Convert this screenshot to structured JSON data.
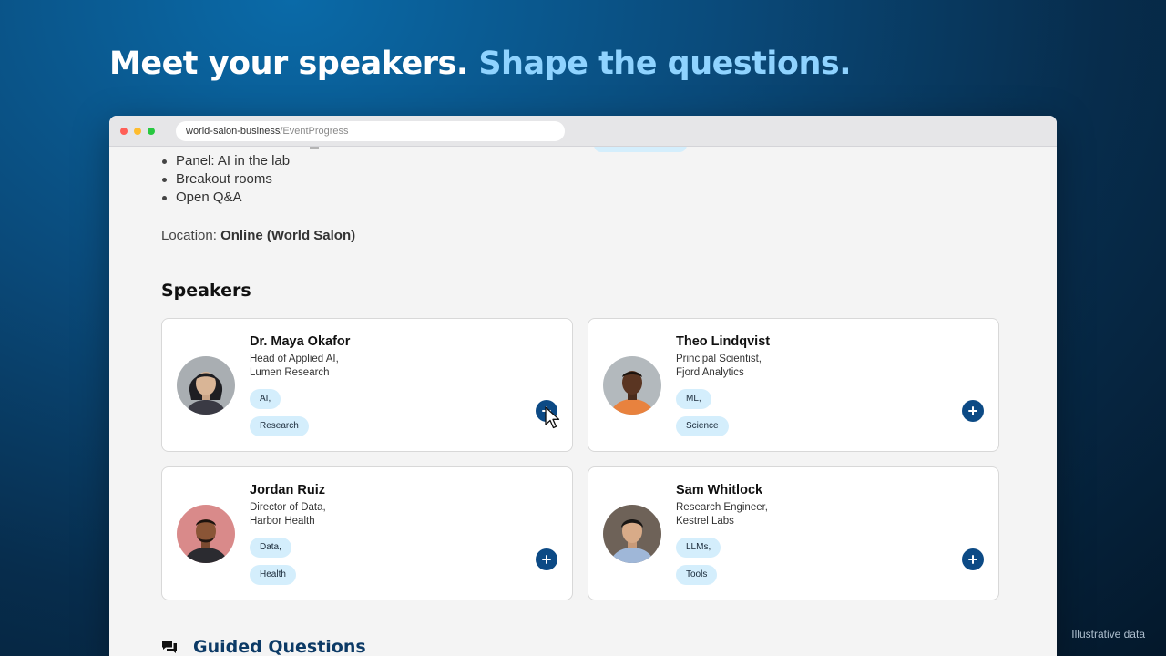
{
  "headline": {
    "part1": "Meet your speakers.",
    "part2": "Shape the questions."
  },
  "footnote": "Illustrative data",
  "browser": {
    "url_domain": "world-salon-business",
    "url_path": "/EventProgress"
  },
  "agenda": {
    "items": [
      "Panel: AI in the lab",
      "Breakout rooms",
      "Open Q&A"
    ]
  },
  "location": {
    "label": "Location:",
    "value": "Online (World Salon)"
  },
  "speakers": {
    "title": "Speakers",
    "items": [
      {
        "name": "Dr. Maya Okafor",
        "role": "Head of Applied AI,",
        "org": "Lumen Research",
        "tags": [
          "AI,",
          "Research"
        ]
      },
      {
        "name": "Theo Lindqvist",
        "role": "Principal Scientist,",
        "org": "Fjord Analytics",
        "tags": [
          "ML,",
          "Science"
        ]
      },
      {
        "name": "Jordan Ruiz",
        "role": "Director of Data,",
        "org": "Harbor Health",
        "tags": [
          "Data,",
          "Health"
        ]
      },
      {
        "name": "Sam Whitlock",
        "role": "Research Engineer,",
        "org": "Kestrel Labs",
        "tags": [
          "LLMs,",
          "Tools"
        ]
      }
    ]
  },
  "guided_questions": {
    "title": "Guided Questions",
    "icon": "chat-bubbles-icon"
  },
  "colors": {
    "accent_text": "#8fd3ff",
    "primary_button": "#0c4a85",
    "tag_background": "#d4eefc",
    "section_title": "#0c3a66"
  }
}
